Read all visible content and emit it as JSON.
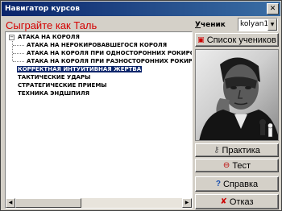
{
  "window": {
    "title": "Навигатор курсов",
    "close_symbol": "✕"
  },
  "header": {
    "title": "Сыграйте как Таль",
    "student_label_first": "У",
    "student_label_rest": "ченик",
    "student_selected": "kolyan1"
  },
  "tree": {
    "items": [
      {
        "label": "АТАКА НА КОРОЛЯ",
        "level": 0,
        "expander": "−",
        "selected": false
      },
      {
        "label": "АТАКА НА НЕРОКИРОВАВШЕГОСЯ КОРОЛЯ",
        "level": 1,
        "selected": false
      },
      {
        "label": "АТАКА НА КОРОЛЯ ПРИ ОДНОСТОРОННИХ РОКИРОВ",
        "level": 1,
        "selected": false
      },
      {
        "label": "АТАКА НА КОРОЛЯ ПРИ РАЗНОСТОРОННИХ РОКИРОВ",
        "level": 1,
        "selected": false
      },
      {
        "label": "КОРРЕКТНАЯ ИНТУИТИВНАЯ ЖЕРТВА",
        "level": 0,
        "selected": true
      },
      {
        "label": "ТАКТИЧЕСКИЕ УДАРЫ",
        "level": 0,
        "selected": false
      },
      {
        "label": "СТРАТЕГИЧЕСКИЕ ПРИЕМЫ",
        "level": 0,
        "selected": false
      },
      {
        "label": "ТЕХНИКА ЭНДШПИЛЯ",
        "level": 0,
        "selected": false
      }
    ]
  },
  "buttons": {
    "students": "Список учеников",
    "practice": "Практика",
    "test": "Тест",
    "help": "Справка",
    "cancel": "Отказ"
  },
  "icons": {
    "students": "student-list-icon",
    "practice": "key-icon",
    "test": "test-icon",
    "help": "help-icon",
    "cancel": "cancel-icon"
  },
  "colors": {
    "title_accent": "#d40000",
    "selection": "#0a246a",
    "titlebar_start": "#0a246a"
  }
}
